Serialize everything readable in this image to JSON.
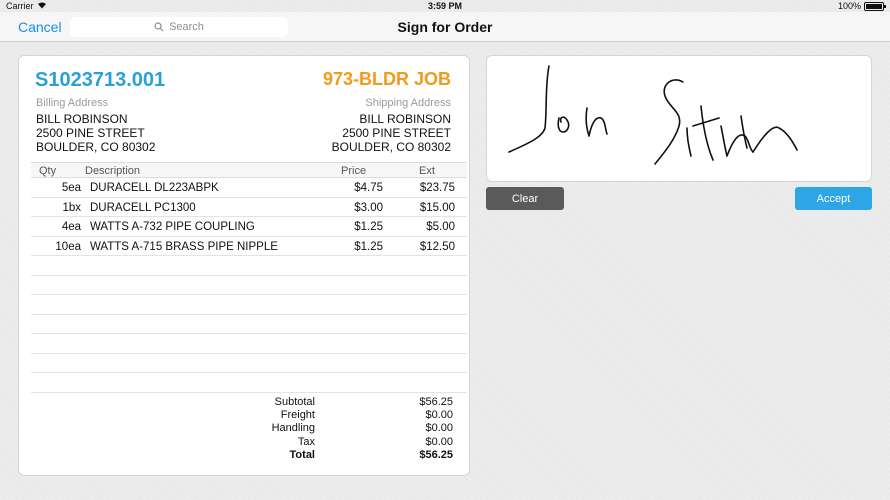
{
  "status_bar": {
    "carrier": "Carrier",
    "time": "3:59 PM",
    "battery_text": "100%",
    "battery_level": 1.0
  },
  "nav": {
    "cancel_label": "Cancel",
    "search_placeholder": "Search",
    "title": "Sign for Order"
  },
  "order": {
    "number": "S1023713.001",
    "job": "973-BLDR JOB",
    "billing_label": "Billing Address",
    "shipping_label": "Shipping Address",
    "billing": [
      "BILL ROBINSON",
      "2500 PINE STREET",
      "BOULDER, CO  80302"
    ],
    "shipping": [
      "BILL ROBINSON",
      "2500 PINE STREET",
      "BOULDER, CO  80302"
    ],
    "columns": {
      "qty": "Qty",
      "description": "Description",
      "price": "Price",
      "ext": "Ext"
    },
    "items": [
      {
        "qty": "5ea",
        "description": "DURACELL DL223ABPK",
        "price": "$4.75",
        "ext": "$23.75"
      },
      {
        "qty": "1bx",
        "description": "DURACELL PC1300",
        "price": "$3.00",
        "ext": "$15.00"
      },
      {
        "qty": "4ea",
        "description": "WATTS A-732 PIPE COUPLING",
        "price": "$1.25",
        "ext": "$5.00"
      },
      {
        "qty": "10ea",
        "description": "WATTS A-715 BRASS PIPE NIPPLE",
        "price": "$1.25",
        "ext": "$12.50"
      },
      {
        "qty": "",
        "description": "",
        "price": "",
        "ext": ""
      },
      {
        "qty": "",
        "description": "",
        "price": "",
        "ext": ""
      },
      {
        "qty": "",
        "description": "",
        "price": "",
        "ext": ""
      },
      {
        "qty": "",
        "description": "",
        "price": "",
        "ext": ""
      },
      {
        "qty": "",
        "description": "",
        "price": "",
        "ext": ""
      },
      {
        "qty": "",
        "description": "",
        "price": "",
        "ext": ""
      },
      {
        "qty": "",
        "description": "",
        "price": "",
        "ext": ""
      }
    ],
    "totals": [
      {
        "label": "Subtotal",
        "value": "$56.25"
      },
      {
        "label": "Freight",
        "value": "$0.00"
      },
      {
        "label": "Handling",
        "value": "$0.00"
      },
      {
        "label": "Tax",
        "value": "$0.00"
      },
      {
        "label": "Total",
        "value": "$56.25"
      }
    ]
  },
  "signature": {
    "clear_label": "Clear",
    "accept_label": "Accept"
  },
  "colors": {
    "accent_blue": "#2aa0da",
    "job_orange": "#f29a1b",
    "clear_gray": "#5a5a5a",
    "accept_blue": "#2ea6e6"
  }
}
